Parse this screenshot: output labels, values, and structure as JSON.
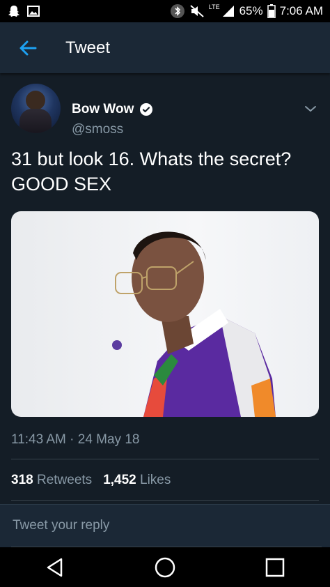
{
  "status_bar": {
    "network_label": "LTE",
    "battery": "65%",
    "time": "7:06 AM",
    "icons": [
      "snapchat-icon",
      "gallery-icon",
      "bluetooth-icon",
      "mute-icon",
      "signal-icon",
      "battery-icon"
    ]
  },
  "header": {
    "title": "Tweet",
    "back_icon": "back-arrow-icon"
  },
  "tweet": {
    "author_name": "Bow Wow",
    "handle": "@smoss",
    "text_line1": "31 but look 16. Whats the secret?",
    "text_line2": "GOOD SEX",
    "timestamp": "11:43 AM · 24 May 18",
    "retweets_count": "318",
    "retweets_label": "Retweets",
    "likes_count": "1,452",
    "likes_label": "Likes"
  },
  "reply": {
    "placeholder": "Tweet your reply"
  },
  "colors": {
    "background": "#141d26",
    "header": "#1b2836",
    "accent": "#1da1f2",
    "secondary_text": "#8899a6"
  }
}
